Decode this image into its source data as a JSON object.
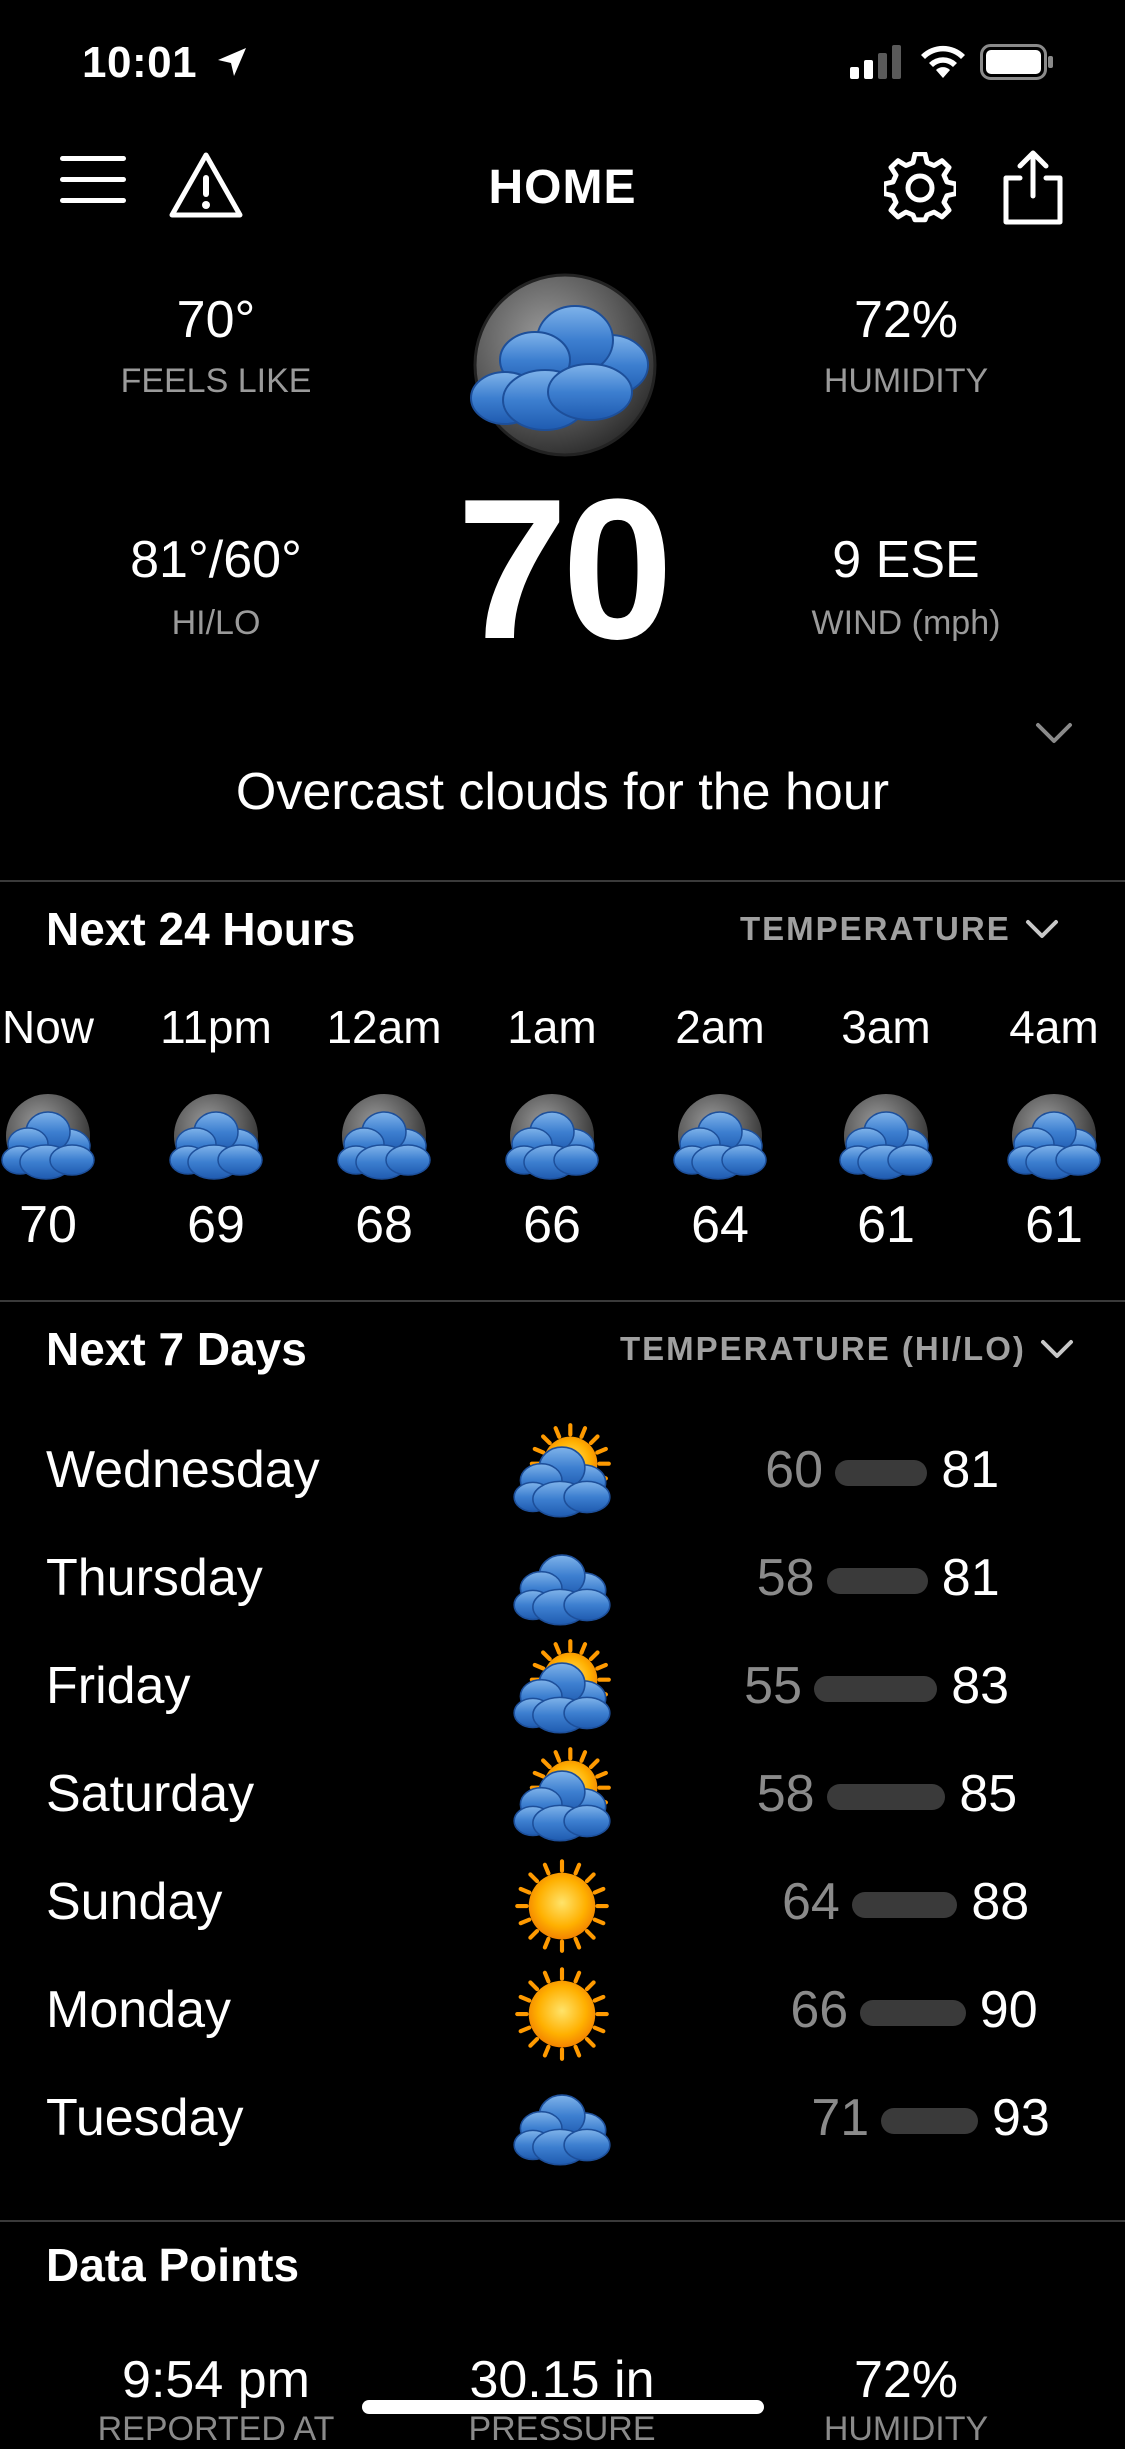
{
  "status_bar": {
    "time": "10:01"
  },
  "nav": {
    "title": "HOME"
  },
  "current": {
    "feels_like_value": "70°",
    "feels_like_label": "FEELS LIKE",
    "humidity_value": "72%",
    "humidity_label": "HUMIDITY",
    "hilo_value": "81°/60°",
    "hilo_label": "HI/LO",
    "wind_value": "9 ESE",
    "wind_label": "WIND (mph)",
    "temperature": "70",
    "summary": "Overcast clouds for the hour",
    "icon": "overcast-cloud-icon"
  },
  "hourly": {
    "title": "Next 24 Hours",
    "selector": "TEMPERATURE",
    "hours": [
      {
        "time": "Now",
        "temp": "70",
        "icon": "overcast-cloud-icon"
      },
      {
        "time": "11pm",
        "temp": "69",
        "icon": "overcast-cloud-icon"
      },
      {
        "time": "12am",
        "temp": "68",
        "icon": "overcast-cloud-icon"
      },
      {
        "time": "1am",
        "temp": "66",
        "icon": "overcast-cloud-icon"
      },
      {
        "time": "2am",
        "temp": "64",
        "icon": "overcast-cloud-icon"
      },
      {
        "time": "3am",
        "temp": "61",
        "icon": "overcast-cloud-icon"
      },
      {
        "time": "4am",
        "temp": "61",
        "icon": "overcast-cloud-icon"
      }
    ]
  },
  "daily": {
    "title": "Next 7 Days",
    "selector": "TEMPERATURE (HI/LO)",
    "days": [
      {
        "name": "Wednesday",
        "lo": "60",
        "hi": "81",
        "icon": "partly-cloudy-icon"
      },
      {
        "name": "Thursday",
        "lo": "58",
        "hi": "81",
        "icon": "cloudy-icon"
      },
      {
        "name": "Friday",
        "lo": "55",
        "hi": "83",
        "icon": "partly-cloudy-icon"
      },
      {
        "name": "Saturday",
        "lo": "58",
        "hi": "85",
        "icon": "partly-cloudy-icon"
      },
      {
        "name": "Sunday",
        "lo": "64",
        "hi": "88",
        "icon": "sun-icon"
      },
      {
        "name": "Monday",
        "lo": "66",
        "hi": "90",
        "icon": "sun-icon"
      },
      {
        "name": "Tuesday",
        "lo": "71",
        "hi": "93",
        "icon": "cloudy-icon"
      }
    ]
  },
  "data_points": {
    "title": "Data Points",
    "reported_value": "9:54 pm",
    "reported_label": "REPORTED AT",
    "pressure_value": "30.15 in",
    "pressure_label": "PRESSURE",
    "humidity_value": "72%",
    "humidity_label": "HUMIDITY"
  }
}
